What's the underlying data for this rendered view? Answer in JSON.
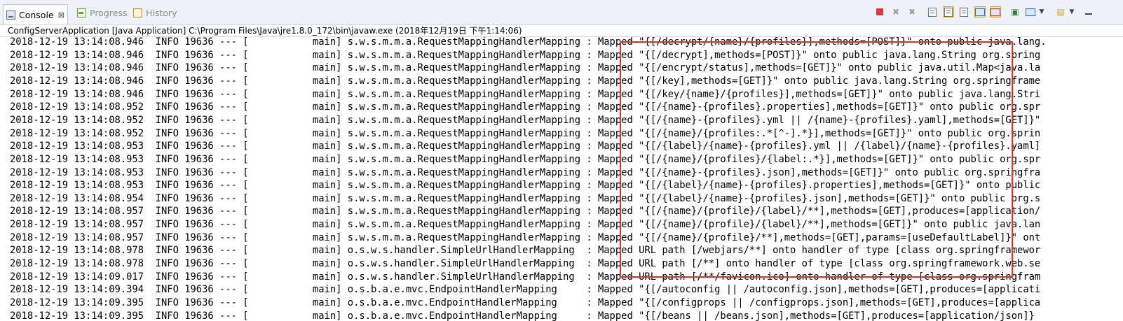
{
  "tabs": [
    {
      "label": "Console",
      "icon": "console-icon",
      "active": true,
      "close": "⊠"
    },
    {
      "label": "Progress",
      "icon": "progress-icon",
      "active": false
    },
    {
      "label": "History",
      "icon": "history-icon",
      "active": false
    }
  ],
  "toolbar": {
    "icons": [
      "terminate-icon",
      "remove-launch-icon",
      "remove-all-terminated-icon",
      "clear-console-icon",
      "scroll-lock-icon",
      "word-wrap-icon",
      "show-on-stdout-icon",
      "show-on-stderr-icon",
      "pin-console-icon",
      "display-selected-console-icon",
      "open-console-icon",
      "minimize-icon",
      "maximize-icon"
    ],
    "colors": {
      "terminate": "#d83a3a",
      "disabled": "#9a9a9a",
      "selected_bg": "#f7e3a6"
    }
  },
  "process": {
    "title": "ConfigServerApplication [Java Application] C:\\Program Files\\Java\\jre1.8.0_172\\bin\\javaw.exe (2018年12月19日 下午1:14:06)"
  },
  "console": {
    "lines": [
      "2018-12-19 13:14:08.946  INFO 19636 --- [           main] s.w.s.m.m.a.RequestMappingHandlerMapping : Mapped \"{[/decrypt/{name}/{profiles}],methods=[POST]}\" onto public java.lang.",
      "2018-12-19 13:14:08.946  INFO 19636 --- [           main] s.w.s.m.m.a.RequestMappingHandlerMapping : Mapped \"{[/decrypt],methods=[POST]}\" onto public java.lang.String org.spring",
      "2018-12-19 13:14:08.946  INFO 19636 --- [           main] s.w.s.m.m.a.RequestMappingHandlerMapping : Mapped \"{[/encrypt/status],methods=[GET]}\" onto public java.util.Map<java.la",
      "2018-12-19 13:14:08.946  INFO 19636 --- [           main] s.w.s.m.m.a.RequestMappingHandlerMapping : Mapped \"{[/key],methods=[GET]}\" onto public java.lang.String org.springframe",
      "2018-12-19 13:14:08.946  INFO 19636 --- [           main] s.w.s.m.m.a.RequestMappingHandlerMapping : Mapped \"{[/key/{name}/{profiles}],methods=[GET]}\" onto public java.lang.Stri",
      "2018-12-19 13:14:08.952  INFO 19636 --- [           main] s.w.s.m.m.a.RequestMappingHandlerMapping : Mapped \"{[/{name}-{profiles}.properties],methods=[GET]}\" onto public org.spr",
      "2018-12-19 13:14:08.952  INFO 19636 --- [           main] s.w.s.m.m.a.RequestMappingHandlerMapping : Mapped \"{[/{name}-{profiles}.yml || /{name}-{profiles}.yaml],methods=[GET]}\"",
      "2018-12-19 13:14:08.952  INFO 19636 --- [           main] s.w.s.m.m.a.RequestMappingHandlerMapping : Mapped \"{[/{name}/{profiles:.*[^-].*}],methods=[GET]}\" onto public org.sprin",
      "2018-12-19 13:14:08.953  INFO 19636 --- [           main] s.w.s.m.m.a.RequestMappingHandlerMapping : Mapped \"{[/{label}/{name}-{profiles}.yml || /{label}/{name}-{profiles}.yaml]",
      "2018-12-19 13:14:08.953  INFO 19636 --- [           main] s.w.s.m.m.a.RequestMappingHandlerMapping : Mapped \"{[/{name}/{profiles}/{label:.*}],methods=[GET]}\" onto public org.spr",
      "2018-12-19 13:14:08.953  INFO 19636 --- [           main] s.w.s.m.m.a.RequestMappingHandlerMapping : Mapped \"{[/{name}-{profiles}.json],methods=[GET]}\" onto public org.springfra",
      "2018-12-19 13:14:08.953  INFO 19636 --- [           main] s.w.s.m.m.a.RequestMappingHandlerMapping : Mapped \"{[/{label}/{name}-{profiles}.properties],methods=[GET]}\" onto public",
      "2018-12-19 13:14:08.954  INFO 19636 --- [           main] s.w.s.m.m.a.RequestMappingHandlerMapping : Mapped \"{[/{label}/{name}-{profiles}.json],methods=[GET]}\" onto public org.s",
      "2018-12-19 13:14:08.957  INFO 19636 --- [           main] s.w.s.m.m.a.RequestMappingHandlerMapping : Mapped \"{[/{name}/{profile}/{label}/**],methods=[GET],produces=[application/",
      "2018-12-19 13:14:08.957  INFO 19636 --- [           main] s.w.s.m.m.a.RequestMappingHandlerMapping : Mapped \"{[/{name}/{profile}/{label}/**],methods=[GET]}\" onto public java.lan",
      "2018-12-19 13:14:08.957  INFO 19636 --- [           main] s.w.s.m.m.a.RequestMappingHandlerMapping : Mapped \"{[/{name}/{profile}/**],methods=[GET],params=[useDefaultLabel]}\" ont",
      "2018-12-19 13:14:08.978  INFO 19636 --- [           main] o.s.w.s.handler.SimpleUrlHandlerMapping  : Mapped URL path [/webjars/**] onto handler of type [class org.springframewor",
      "2018-12-19 13:14:08.978  INFO 19636 --- [           main] o.s.w.s.handler.SimpleUrlHandlerMapping  : Mapped URL path [/**] onto handler of type [class org.springframework.web.se",
      "2018-12-19 13:14:09.017  INFO 19636 --- [           main] o.s.w.s.handler.SimpleUrlHandlerMapping  : Mapped URL path [/**/favicon.ico] onto handler of type [class org.springfram",
      "2018-12-19 13:14:09.394  INFO 19636 --- [           main] o.s.b.a.e.mvc.EndpointHandlerMapping     : Mapped \"{[/autoconfig || /autoconfig.json],methods=[GET],produces=[applicati",
      "2018-12-19 13:14:09.395  INFO 19636 --- [           main] o.s.b.a.e.mvc.EndpointHandlerMapping     : Mapped \"{[/configprops || /configprops.json],methods=[GET],produces=[applica",
      "2018-12-19 13:14:09.395  INFO 19636 --- [           main] o.s.b.a.e.mvc.EndpointHandlerMapping     : Mapped \"{[/beans || /beans.json],methods=[GET],produces=[application/json]}"
    ]
  },
  "annotation": {
    "color": "#e03131"
  }
}
